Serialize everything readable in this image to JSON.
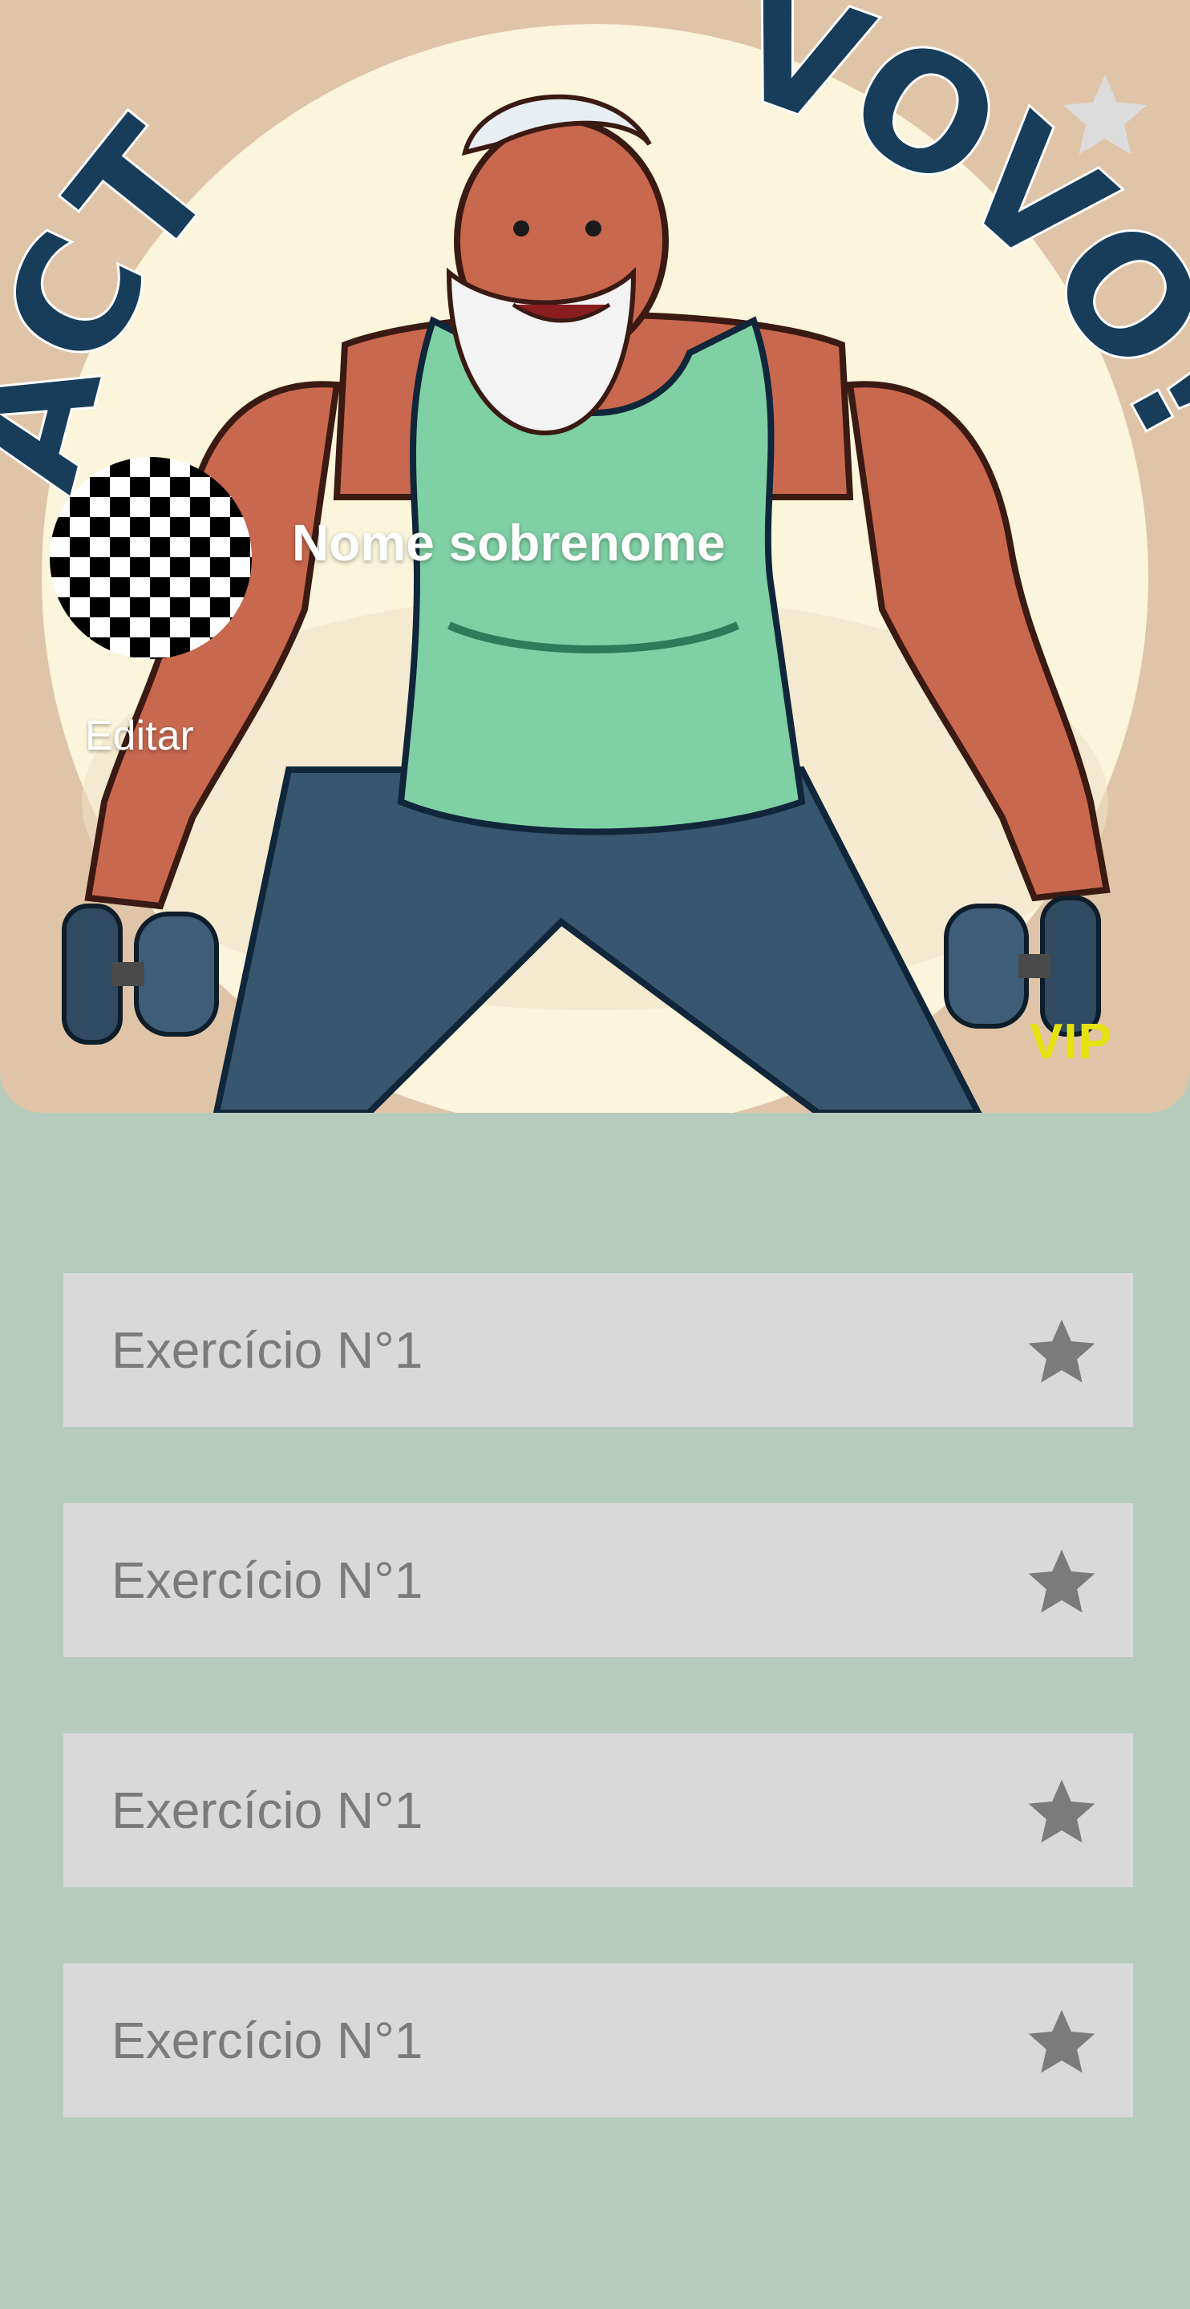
{
  "app": {
    "hero": {
      "title_words": [
        "ACT",
        "VOVO!"
      ],
      "image": "muscular-grandpa-dumbbells-illustration",
      "favorite_icon": "star-icon"
    },
    "profile": {
      "name": "Nome sobrenome",
      "edit_label": "Editar",
      "badge": "VIP",
      "avatar_icon": "checkerboard-avatar"
    },
    "exercises": [
      {
        "label": "Exercício N°1",
        "icon": "star-icon"
      },
      {
        "label": "Exercício N°1",
        "icon": "star-icon"
      },
      {
        "label": "Exercício N°1",
        "icon": "star-icon"
      },
      {
        "label": "Exercício N°1",
        "icon": "star-icon"
      }
    ]
  },
  "colors": {
    "page_background": "#b7cabe",
    "hero_background": "#dfc4a8",
    "hero_circle": "#fbf5dc",
    "title_text": "#173d5a",
    "tank_top": "#7fd0a4",
    "pants": "#37566f",
    "skin": "#c8684f",
    "list_item_bg": "#d9d9d9",
    "list_text": "#7b7b7b",
    "star_gray": "#7b7b7b",
    "vip_yellow": "#e6e20f"
  }
}
